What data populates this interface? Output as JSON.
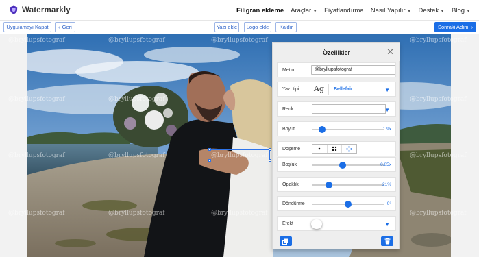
{
  "app": {
    "name": "Watermarkly",
    "brand_color": "#4c2fbd"
  },
  "nav": {
    "items": [
      {
        "label": "Filigran ekleme",
        "active": true,
        "has_menu": false
      },
      {
        "label": "Araçlar",
        "active": false,
        "has_menu": true
      },
      {
        "label": "Fiyatlandırma",
        "active": false,
        "has_menu": false
      },
      {
        "label": "Nasıl Yapılır",
        "active": false,
        "has_menu": true
      },
      {
        "label": "Destek",
        "active": false,
        "has_menu": true
      },
      {
        "label": "Blog",
        "active": false,
        "has_menu": true
      }
    ],
    "chevron": "⌄"
  },
  "toolbar": {
    "close_app": "Uygulamayı Kapat",
    "back": "Geri",
    "add_text": "Yazı ekle",
    "add_logo": "Logo ekle",
    "remove": "Kaldır",
    "next_step": "Sonraki Adım",
    "accent": "#1b6ee6"
  },
  "watermark": {
    "text": "@bryllupsfotograf"
  },
  "panel": {
    "title": "Özellikler",
    "text_label": "Metin",
    "text_value": "@bryllupsfotograf",
    "font_label": "Yazı tipi",
    "font_sample": "Ag",
    "font_name": "Bellefair",
    "color_label": "Renk",
    "size_label": "Boyut",
    "size_value": "1.9x",
    "size_level": 0.14,
    "tiling_label": "Döşeme",
    "spacing_label": "Boşluk",
    "spacing_value": "0.85x",
    "spacing_level": 0.42,
    "opacity_label": "Opaklık",
    "opacity_value": "21%",
    "opacity_level": 0.24,
    "rotation_label": "Döndürme",
    "rotation_value": "0°",
    "rotation_level": 0.5,
    "effect_label": "Efekt"
  }
}
